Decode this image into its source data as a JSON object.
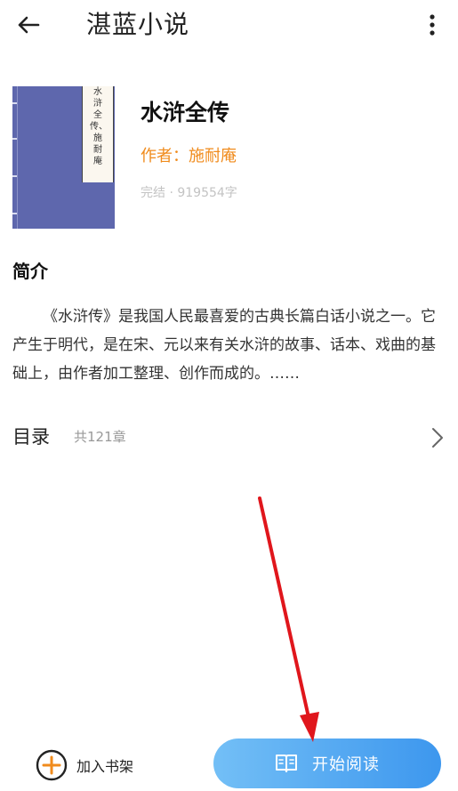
{
  "header": {
    "title": "湛蓝小说",
    "back_icon": "arrow-left-icon",
    "more_icon": "more-vertical-icon"
  },
  "book": {
    "cover_label": "水浒全传、施耐庵",
    "title": "水浒全传",
    "author": "作者：施耐庵",
    "meta": "完结 · 919554字"
  },
  "intro": {
    "heading": "简介",
    "text": "《水浒传》是我国人民最喜爱的古典长篇白话小说之一。它产生于明代，是在宋、元以来有关水浒的故事、话本、戏曲的基础上，由作者加工整理、创作而成的。……"
  },
  "toc": {
    "label": "目录",
    "count": "共121章"
  },
  "bottom": {
    "add_shelf_label": "加入书架",
    "start_read_label": "开始阅读"
  },
  "colors": {
    "accent_orange": "#f08b1c",
    "button_blue_start": "#73bff6",
    "button_blue_end": "#3d97ee",
    "annotation_arrow": "#e0161c"
  }
}
